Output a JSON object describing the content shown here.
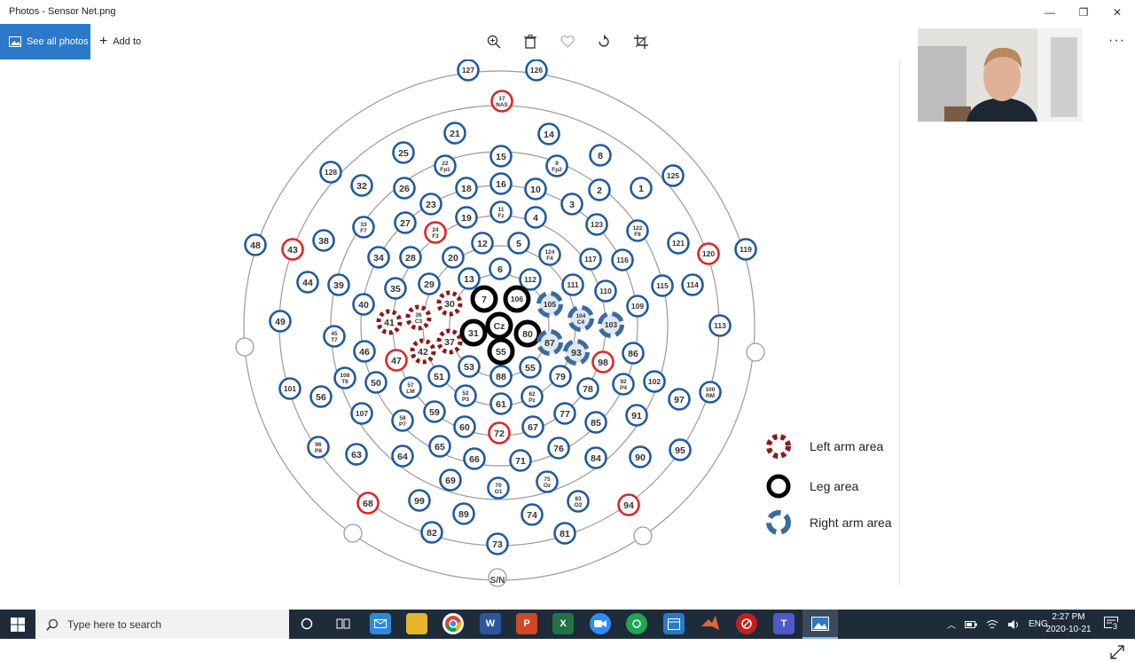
{
  "window": {
    "title": "Photos - Sensor Net.png",
    "minimize": "—",
    "maximize": "❐",
    "close": "✕"
  },
  "toolbar": {
    "see_all": "See all photos",
    "add_to": "Add to",
    "more": "···"
  },
  "diagram": {
    "bottom_label": "S/N",
    "legend": [
      {
        "label": "Left arm area",
        "color": "#8b1a1a"
      },
      {
        "label": "Leg area",
        "color": "#000000"
      },
      {
        "label": "Right arm area",
        "color": "#3c6aa0"
      }
    ],
    "electrodes_blue": [
      "127",
      "126",
      "21",
      "14",
      "25",
      "8",
      "22 Fp1",
      "15",
      "9 Fp2",
      "128",
      "32",
      "26",
      "18",
      "16",
      "10",
      "2",
      "1",
      "125",
      "33 F7",
      "27",
      "23",
      "19",
      "11 Fz",
      "4",
      "3",
      "123",
      "122 F8",
      "121",
      "119",
      "48",
      "38",
      "34",
      "28",
      "20",
      "12",
      "5",
      "124 F4",
      "116",
      "117",
      "44",
      "39",
      "29",
      "13",
      "6",
      "112",
      "111",
      "110",
      "115",
      "114",
      "49",
      "40",
      "35",
      "109",
      "45 T7",
      "113",
      "46",
      "108 T8",
      "50",
      "51",
      "53",
      "54",
      "55",
      "79",
      "86",
      "102",
      "101",
      "56",
      "57 LM",
      "52 P3",
      "61",
      "62 Pz",
      "78",
      "92 P4",
      "97",
      "100 RM",
      "107",
      "58 P7",
      "59",
      "60",
      "67",
      "77",
      "85",
      "91",
      "96 P8",
      "63",
      "64",
      "65",
      "66",
      "71",
      "76",
      "84",
      "90",
      "95",
      "99",
      "69",
      "70 O1",
      "75 Oz",
      "83 O2",
      "89",
      "74",
      "82",
      "73",
      "81",
      "88",
      "COM"
    ],
    "electrodes_red": [
      "17 NAS",
      "24 F3",
      "43",
      "120",
      "47",
      "98",
      "72",
      "68",
      "94"
    ],
    "electrodes_left_arm": [
      "30",
      "36 C3",
      "41",
      "37",
      "42"
    ],
    "electrodes_leg": [
      "7",
      "106",
      "Cz",
      "31",
      "80",
      "55"
    ],
    "electrodes_right_arm": [
      "105",
      "104 C4",
      "103",
      "87",
      "93"
    ]
  },
  "taskbar": {
    "search_placeholder": "Type here to search",
    "language": "ENG",
    "time": "2:27 PM",
    "date": "2020-10-21",
    "notifications": "3"
  },
  "colors": {
    "accent": "#2b79c8",
    "electrode_blue": "#1f5aa0",
    "electrode_red": "#e02424"
  }
}
